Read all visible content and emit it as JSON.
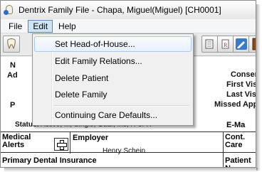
{
  "window": {
    "title": "Dentrix Family File - Chapa, Miguel(Miguel) [CH0001]"
  },
  "menubar": {
    "items": [
      "File",
      "Edit",
      "Help"
    ]
  },
  "edit_menu": {
    "items": [
      "Set Head-of-House...",
      "Edit Family Relations...",
      "Delete Patient",
      "Delete Family",
      "Continuing Care Defaults..."
    ]
  },
  "patient_panel": {
    "left_labels": [
      "N",
      "Ad",
      "P"
    ],
    "right_labels": [
      "Conser",
      "First Visi",
      "Last Visi",
      "Missed App"
    ],
    "status_label": "Status:",
    "status_value": "Active, M, Single, Guar, Ins, H-of-H",
    "email_label": "E-Ma"
  },
  "grid": {
    "medical_alerts": "Medical Alerts",
    "employer_label": "Employer",
    "employer_value": "Henry Schein",
    "cont_care": "Cont. Care",
    "primary_dental": "Primary Dental Insurance",
    "patient_n": "Patient N"
  },
  "toolbar": {
    "icons": [
      "tooth-icon",
      "patient-chart-icon",
      "prescription-icon",
      "edit-pen-icon",
      "exit-door-icon"
    ]
  }
}
